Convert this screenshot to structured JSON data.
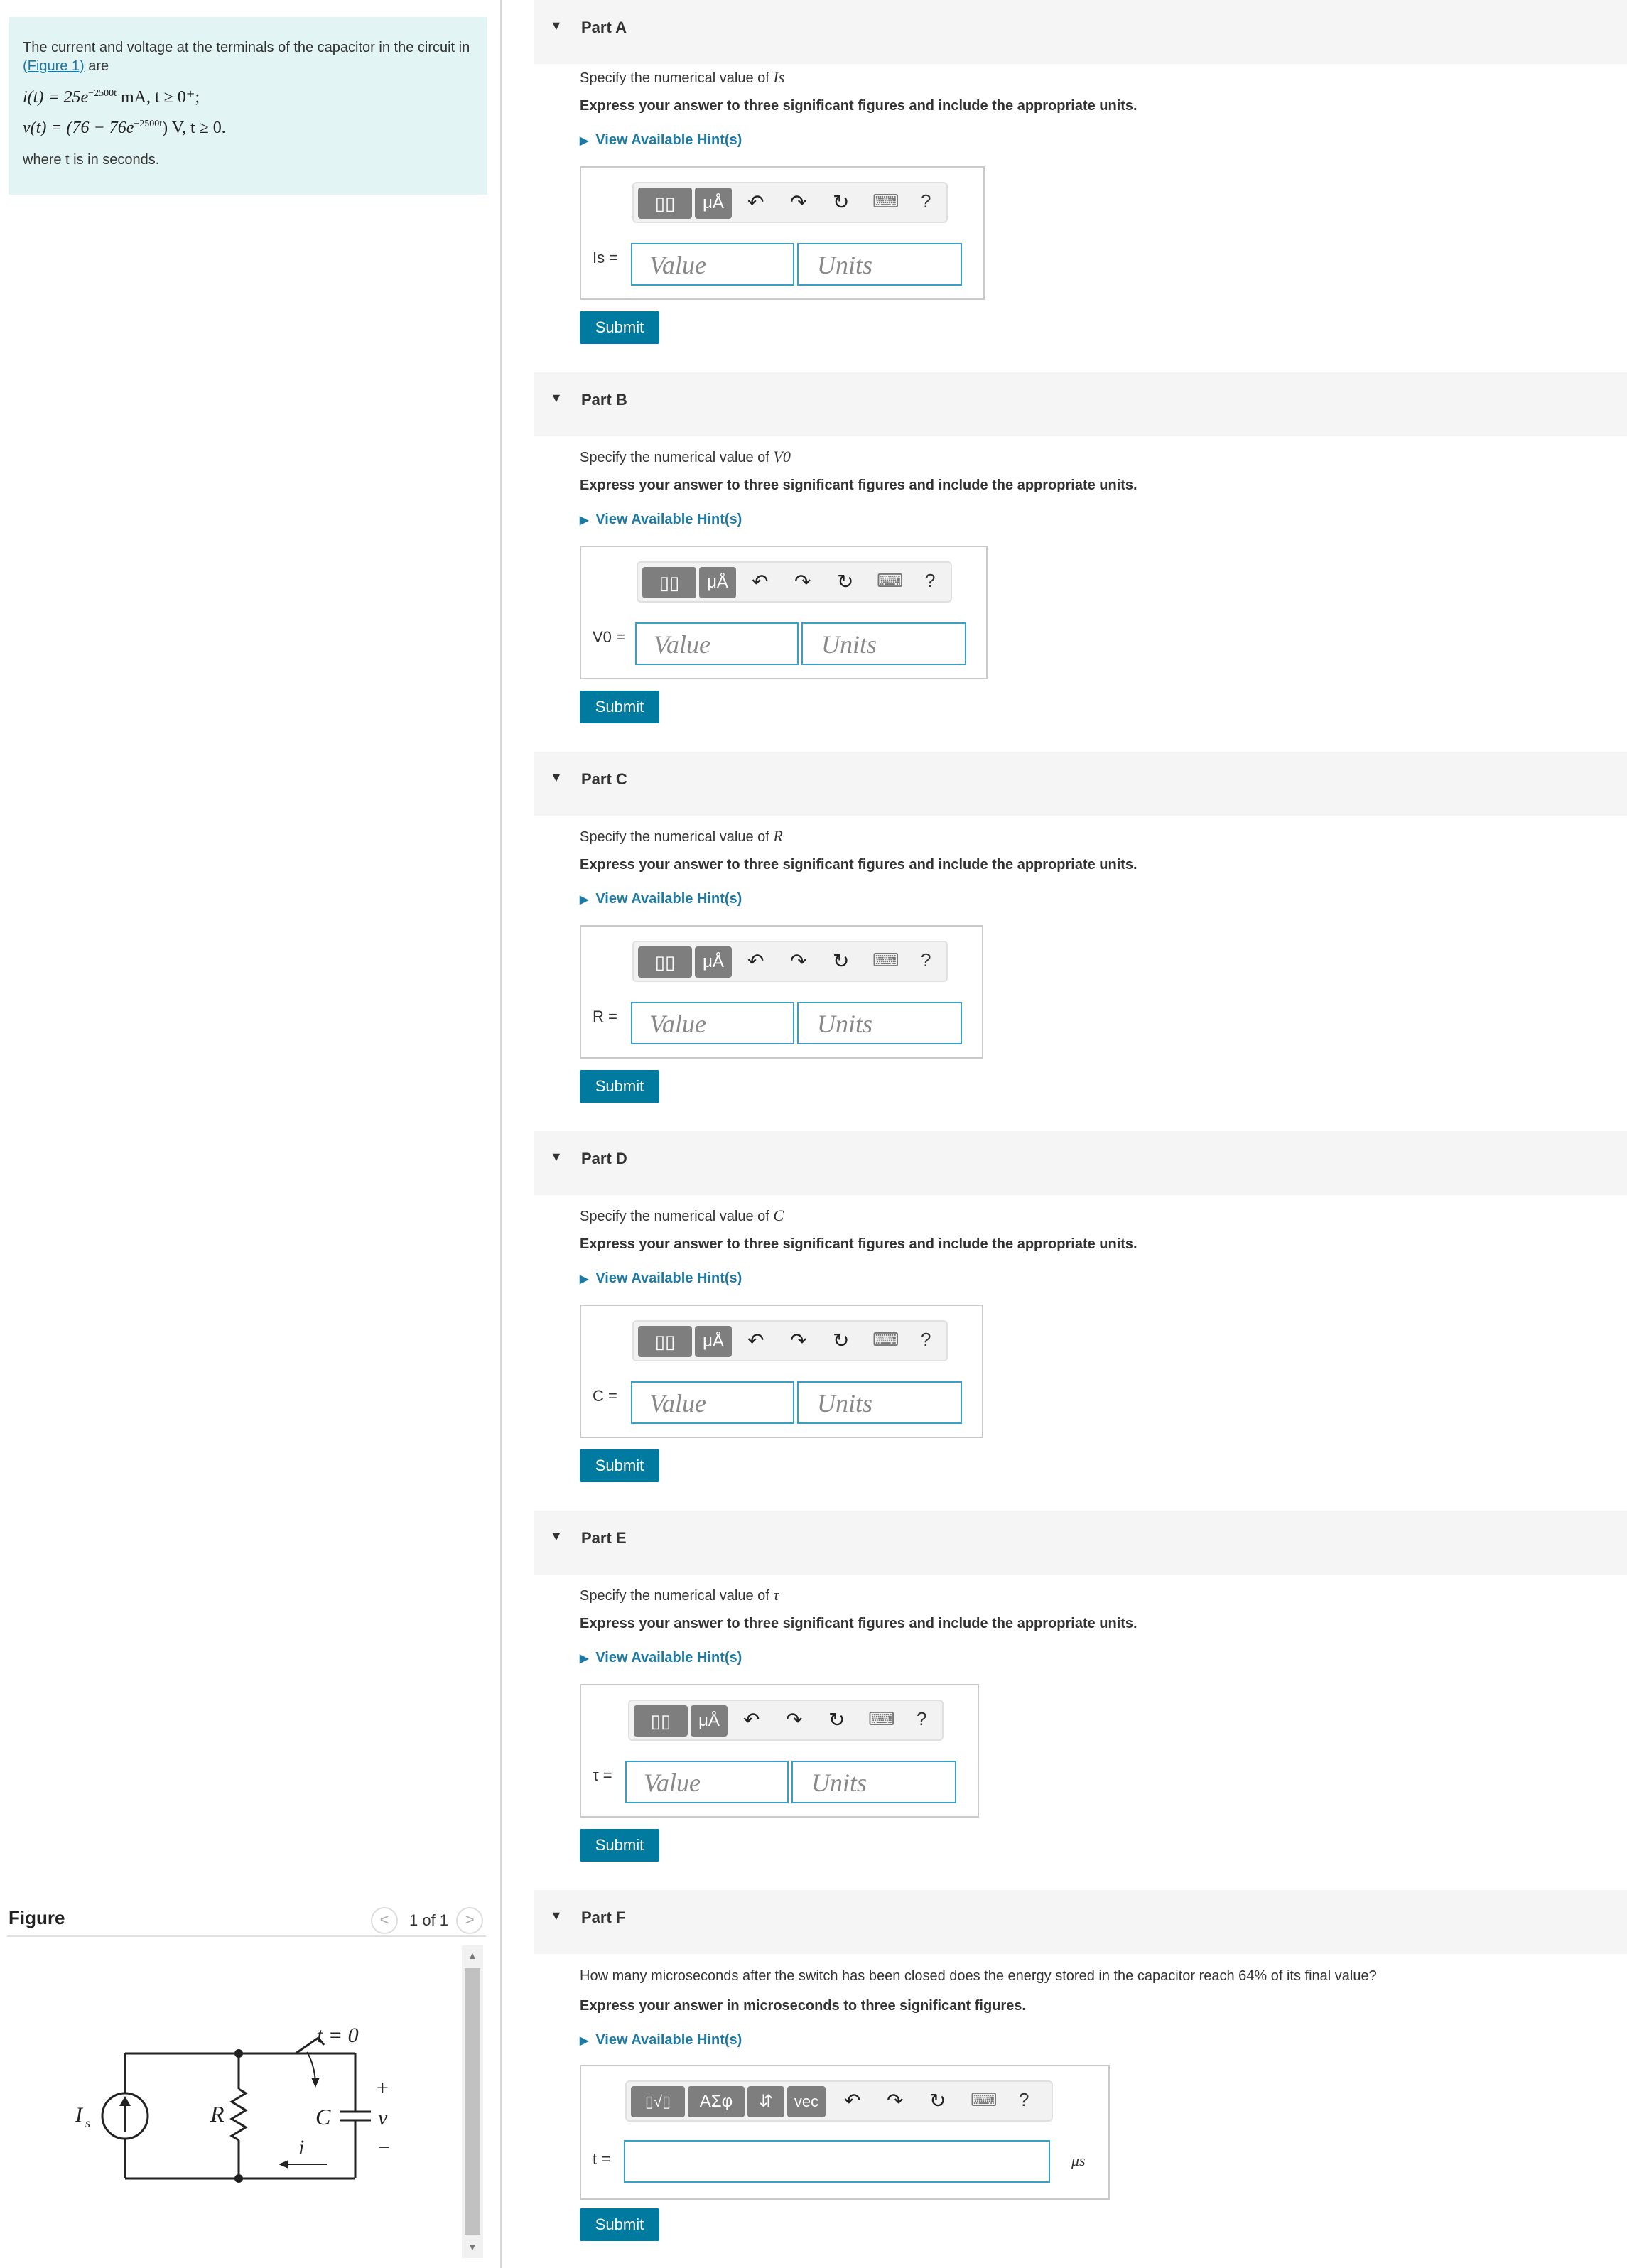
{
  "problem": {
    "intro_before_link": "The current and voltage at the terminals of the capacitor in the circuit in ",
    "figure_link": "(Figure 1)",
    "intro_after_link": " are",
    "eq_i": "i(t) = 25e",
    "eq_i_exp": "−2500t",
    "eq_i_tail": " mA, t ≥ 0⁺;",
    "eq_v": "v(t) = (76 − 76e",
    "eq_v_exp": "−2500t",
    "eq_v_tail": ") V, t ≥ 0.",
    "where": "where t is in seconds."
  },
  "figure": {
    "title": "Figure",
    "prev": "<",
    "count": "1 of 1",
    "next": ">",
    "labels": {
      "source": "I",
      "source_sub": "s",
      "resistor": "R",
      "capacitor": "C",
      "switch": "t = 0",
      "plus": "+",
      "minus": "−",
      "voltage": "v",
      "current": "i"
    }
  },
  "toolbar": {
    "templates": "▯▯",
    "units": "μÅ",
    "undo": "↶",
    "redo": "↷",
    "reset": "↻",
    "keyboard": "⌨",
    "help": "?",
    "sqrt": "▯√▯",
    "greek": "ΑΣφ",
    "arrows": "⇵",
    "vec": "vec"
  },
  "common": {
    "instruction": "Express your answer to three significant figures and include the appropriate units.",
    "hint": "View Available Hint(s)",
    "value_placeholder": "Value",
    "units_placeholder": "Units",
    "submit": "Submit",
    "caret": "▼"
  },
  "parts": [
    {
      "title": "Part A",
      "question": "Specify the numerical value of ",
      "var": "Is",
      "label": "Is ="
    },
    {
      "title": "Part B",
      "question": "Specify the numerical value of ",
      "var": "V0",
      "label": "V0 ="
    },
    {
      "title": "Part C",
      "question": "Specify the numerical value of ",
      "var": "R",
      "label": "R ="
    },
    {
      "title": "Part D",
      "question": "Specify the numerical value of ",
      "var": "C",
      "label": "C ="
    },
    {
      "title": "Part E",
      "question": "Specify the numerical value of ",
      "var": "τ",
      "label": "τ ="
    },
    {
      "title": "Part F",
      "question": "How many microseconds after the switch has been closed does the energy stored in the capacitor reach 64% of its final value?",
      "instruction": "Express your answer in microseconds to three significant figures.",
      "label": "t =",
      "unit": "μs"
    }
  ]
}
